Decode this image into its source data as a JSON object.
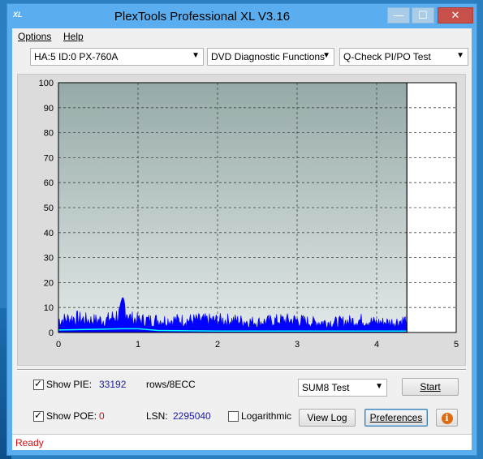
{
  "window": {
    "title": "PlexTools Professional XL V3.16",
    "icon_text": "XL",
    "minimize": "—",
    "maximize": "☐",
    "close": "✕"
  },
  "menu": [
    {
      "label": "Options"
    },
    {
      "label": "Help"
    }
  ],
  "toolbar": {
    "drive": "HA:5 ID:0  PX-760A",
    "function": "DVD Diagnostic Functions",
    "test": "Q-Check PI/PO Test"
  },
  "chart_data": {
    "type": "area",
    "x_ticks": [
      "0",
      "1",
      "2",
      "3",
      "4",
      "5"
    ],
    "y_ticks": [
      "0",
      "10",
      "20",
      "30",
      "40",
      "50",
      "60",
      "70",
      "80",
      "90",
      "100"
    ],
    "xlim": [
      0,
      5
    ],
    "ylim": [
      0,
      100
    ],
    "grid": true,
    "end_marker_x": 4.38,
    "series": [
      {
        "color": "#0000ff",
        "x": [
          0,
          0.2,
          0.4,
          0.6,
          0.78,
          0.82,
          0.9,
          1.0,
          1.2,
          1.5,
          1.8,
          2.0,
          2.2,
          2.5,
          2.8,
          3.0,
          3.2,
          3.5,
          3.8,
          4.0,
          4.2,
          4.38
        ],
        "values": [
          6,
          7,
          6,
          6,
          9,
          14,
          7,
          6,
          6,
          6,
          6,
          6,
          6,
          5,
          6,
          6,
          5,
          5,
          6,
          5,
          5,
          6
        ]
      },
      {
        "color": "#00ffff",
        "x": [
          0,
          0.8,
          1.0,
          1.25,
          2.0,
          3.0,
          4.0,
          4.38
        ],
        "values": [
          1,
          1.5,
          1.5,
          0.8,
          0.6,
          0.6,
          0.6,
          0.6
        ]
      }
    ],
    "background_colors": {
      "top": "#95aaa8",
      "bottom": "#e2e8e8"
    }
  },
  "controls": {
    "show_pie_label": "Show PIE:",
    "show_pie_checked": true,
    "pie_value": "33192",
    "pie_unit": "rows/8ECC",
    "sum_select": "SUM8 Test",
    "start_label": "Start",
    "show_poe_label": "Show POE:",
    "show_poe_checked": true,
    "poe_value": "0",
    "lsn_label": "LSN:",
    "lsn_value": "2295040",
    "log_label": "Logarithmic",
    "log_checked": false,
    "view_log_label": "View Log",
    "preferences_label": "Preferences",
    "info_glyph": "i"
  },
  "status": {
    "text": "Ready"
  }
}
